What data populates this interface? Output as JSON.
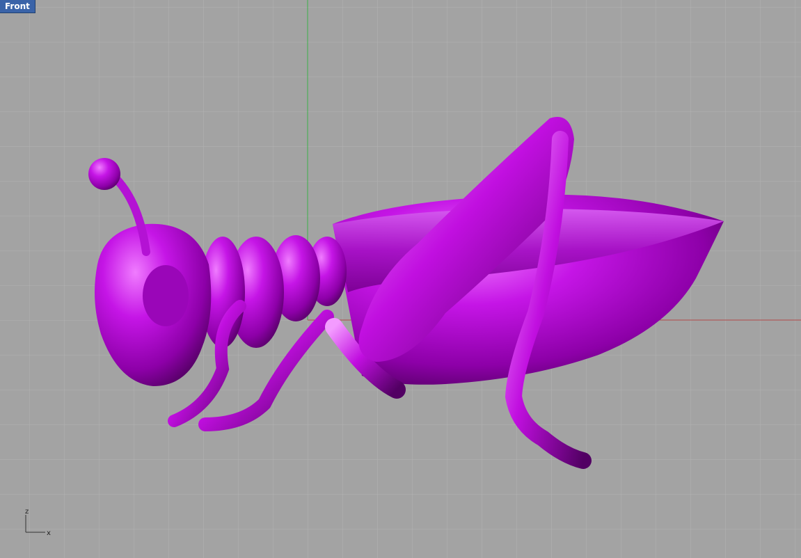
{
  "viewport": {
    "name": "Front",
    "background_color": "#a3a3a3",
    "grid_color": "#b3b3b3",
    "axis_colors": {
      "x": "#b24a4a",
      "y": "#3cb04a"
    }
  },
  "object": {
    "description_icon": "grasshopper-model",
    "color": "#b000d4"
  },
  "axis_indicator": {
    "vertical_label": "z",
    "horizontal_label": "x"
  }
}
